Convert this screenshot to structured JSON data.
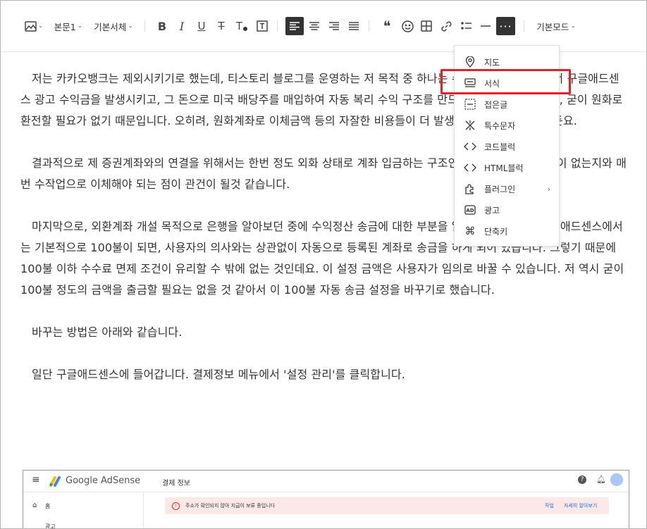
{
  "toolbar": {
    "image_icon": "image-icon",
    "paragraph_style": "본문1",
    "font_family": "기본서체",
    "more_icon": "more-icon",
    "mode": "기본모드"
  },
  "content": {
    "partial_line": "· · · · · · · · ·",
    "paragraphs": [
      "저는 카카오뱅크는 제외시키기로 했는데, 티스토리 블로그를 운영하는 저 목적 중 하나는 수익 파이프를 구축해서 구글애드센스 광고 수익금을 발생시키고, 그 돈으로 미국 배당주를 매입하여 자동 복리 수익 구조를 만드는게 목적이기 때문에, 굳이 원화로 환전할 필요가 없기 때문입니다. 오히려, 원화계좌로 이체금액 등의 자잘한 비용들이 더 발생할 수도 있을 것 같거든요.",
      "결과적으로 제 증권계좌와의 연결을 위해서는 한번 정도 외화 상태로 계좌 입금하는 구조인데요. 그때 드는 비용이 없는지와 매번 수작업으로 이체해야 되는 점이 관건이 될것 같습니다.",
      "마지막으로, 외환계좌 개설 목적으로 은행을 알아보던 중에 수익정산 송금에 대한 부분을 알게 된게 있는데, 구글애드센스에서는 기본적으로 100불이 되면, 사용자의 의사와는 상관없이 자동으로 등록된 계좌로 송금을 하게 되어 있습니다. 그렇기 때문에 100불 이하 수수료 면제 조건이 유리할 수 밖에 없는 것인데요. 이 설정 금액은 사용자가 임의로 바꿀 수 있습니다. 저 역시 굳이 100불 정도의 금액을 출금할 필요는 없을 것 같아서 이 100불 자동 송금 설정을 바꾸기로 했습니다.",
      "바꾸는 방법은 아래와 같습니다.",
      "일단 구글애드센스에 들어갑니다. 결제정보 메뉴에서 '설정 관리'를 클릭합니다."
    ]
  },
  "menu": {
    "items": [
      {
        "label": "지도",
        "icon": "map-pin-icon"
      },
      {
        "label": "서식",
        "icon": "template-icon"
      },
      {
        "label": "접은글",
        "icon": "fold-icon"
      },
      {
        "label": "특수문자",
        "icon": "asterisk-icon"
      },
      {
        "label": "코드블럭",
        "icon": "code-icon"
      },
      {
        "label": "HTML블럭",
        "icon": "html-icon"
      },
      {
        "label": "플러그인",
        "icon": "plugin-icon"
      },
      {
        "label": "광고",
        "icon": "ad-icon"
      },
      {
        "label": "단축키",
        "icon": "command-icon"
      }
    ]
  },
  "embedded_screenshot": {
    "brand": "Google AdSense",
    "page_title": "결제 정보",
    "side_home": "홈",
    "side_ads": "광고",
    "banner_text": "주소가 확인되지 않아 지급이 보류 중입니다",
    "banner_action1": "작업",
    "banner_action2": "자세히 알아보기"
  },
  "colors": {
    "highlight": "#e0202a",
    "active_button": "#333333"
  }
}
